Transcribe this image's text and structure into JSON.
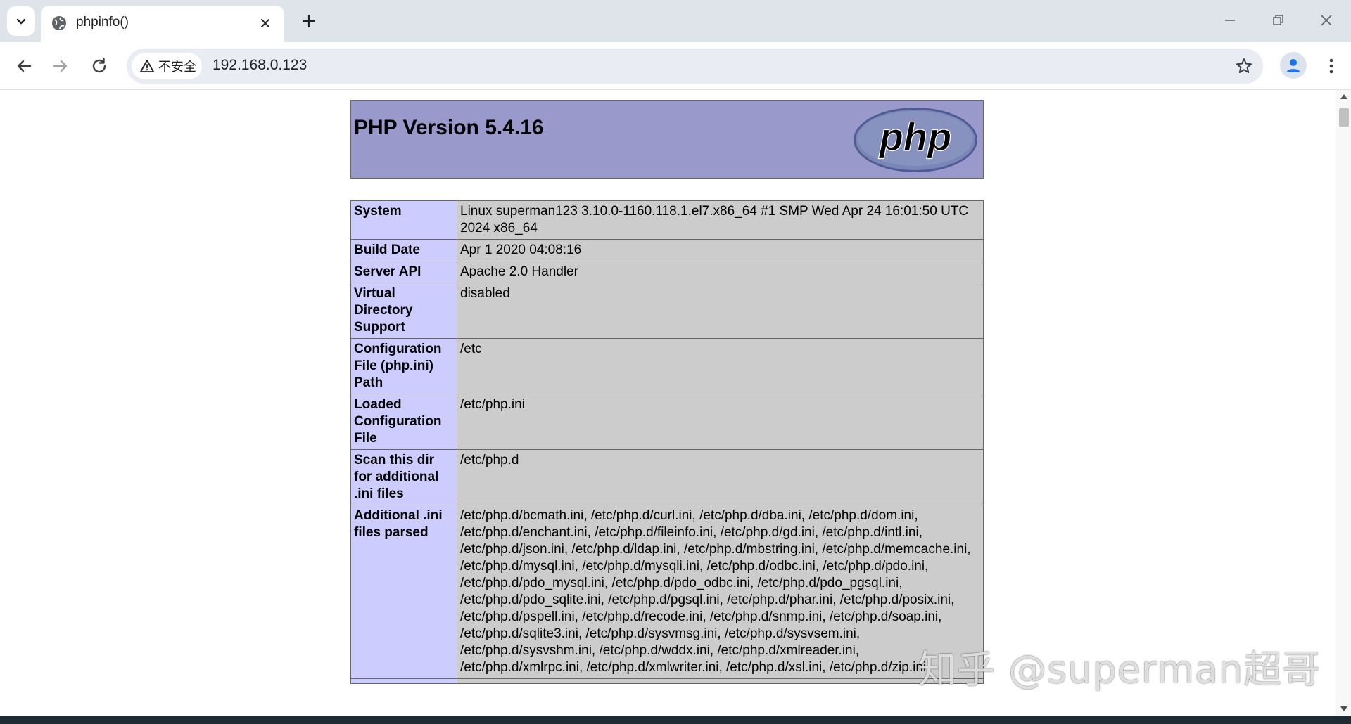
{
  "browser": {
    "tab": {
      "title": "phpinfo()"
    },
    "address": {
      "security_label": "不安全",
      "url": "192.168.0.123"
    },
    "icons": {
      "tab_search": "chevron-down-icon",
      "favicon": "globe-icon",
      "tab_close": "close-icon",
      "new_tab": "plus-icon",
      "minimize": "minimize-icon",
      "restore": "restore-icon",
      "close_window": "close-icon",
      "back": "arrow-left-icon",
      "forward": "arrow-right-icon",
      "reload": "reload-icon",
      "security": "warning-icon",
      "bookmark": "star-icon",
      "profile": "person-icon",
      "menu": "more-vertical-icon"
    }
  },
  "page": {
    "header": {
      "title": "PHP Version 5.4.16",
      "logo_text": "php"
    },
    "rows": [
      {
        "key": "System",
        "value": "Linux superman123 3.10.0-1160.118.1.el7.x86_64 #1 SMP Wed Apr 24 16:01:50 UTC 2024 x86_64"
      },
      {
        "key": "Build Date",
        "value": "Apr 1 2020 04:08:16"
      },
      {
        "key": "Server API",
        "value": "Apache 2.0 Handler"
      },
      {
        "key": "Virtual Directory Support",
        "value": "disabled"
      },
      {
        "key": "Configuration File (php.ini) Path",
        "value": "/etc"
      },
      {
        "key": "Loaded Configuration File",
        "value": "/etc/php.ini"
      },
      {
        "key": "Scan this dir for additional .ini files",
        "value": "/etc/php.d"
      },
      {
        "key": "Additional .ini files parsed",
        "value": "/etc/php.d/bcmath.ini, /etc/php.d/curl.ini, /etc/php.d/dba.ini, /etc/php.d/dom.ini, /etc/php.d/enchant.ini, /etc/php.d/fileinfo.ini, /etc/php.d/gd.ini, /etc/php.d/intl.ini, /etc/php.d/json.ini, /etc/php.d/ldap.ini, /etc/php.d/mbstring.ini, /etc/php.d/memcache.ini, /etc/php.d/mysql.ini, /etc/php.d/mysqli.ini, /etc/php.d/odbc.ini, /etc/php.d/pdo.ini, /etc/php.d/pdo_mysql.ini, /etc/php.d/pdo_odbc.ini, /etc/php.d/pdo_pgsql.ini, /etc/php.d/pdo_sqlite.ini, /etc/php.d/pgsql.ini, /etc/php.d/phar.ini, /etc/php.d/posix.ini, /etc/php.d/pspell.ini, /etc/php.d/recode.ini, /etc/php.d/snmp.ini, /etc/php.d/soap.ini, /etc/php.d/sqlite3.ini, /etc/php.d/sysvmsg.ini, /etc/php.d/sysvsem.ini, /etc/php.d/sysvshm.ini, /etc/php.d/wddx.ini, /etc/php.d/xmlreader.ini, /etc/php.d/xmlrpc.ini, /etc/php.d/xmlwriter.ini, /etc/php.d/xsl.ini, /etc/php.d/zip.ini"
      }
    ]
  },
  "watermark": "知乎 @superman超哥",
  "colors": {
    "header_bg": "#9999cc",
    "key_cell_bg": "#ccccff",
    "value_cell_bg": "#cccccc",
    "border": "#666666",
    "logo_fill": "#6c78af"
  }
}
